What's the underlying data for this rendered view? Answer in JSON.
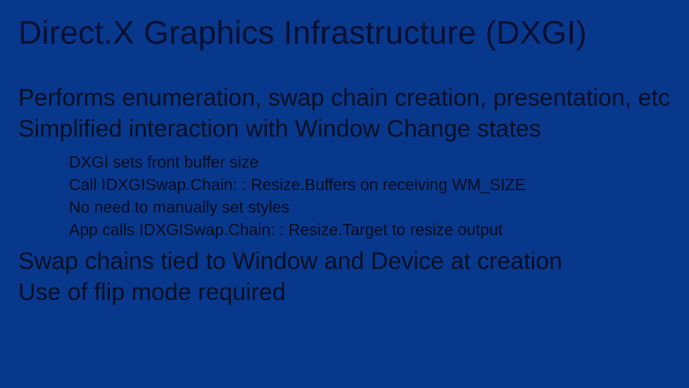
{
  "title": "Direct.X Graphics Infrastructure (DXGI)",
  "body": {
    "line1": "Performs enumeration, swap chain creation, presentation, etc",
    "line2": "Simplified interaction with Window Change states",
    "sub": {
      "s1": "DXGI sets front buffer size",
      "s2": "Call IDXGISwap.Chain: : Resize.Buffers on receiving WM_SIZE",
      "s3": "No need to manually set styles",
      "s4": "App calls IDXGISwap.Chain: : Resize.Target to resize output"
    },
    "line3": "Swap chains tied to Window and Device at creation",
    "line4": "Use of flip mode required"
  }
}
